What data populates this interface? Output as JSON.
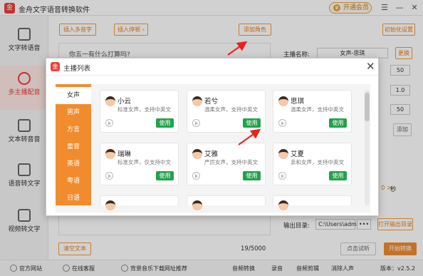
{
  "app": {
    "title": "金舟文字语音转换软件",
    "logo": "金",
    "vip": "开通会员",
    "vip_icon": "crown-icon"
  },
  "window_controls": [
    "☰",
    "—",
    "✕"
  ],
  "sidebar": {
    "items": [
      {
        "label": "文字转语音",
        "icon": "text-to-speech-icon"
      },
      {
        "label": "多主播配音",
        "icon": "multi-anchor-icon",
        "active": true
      },
      {
        "label": "文本转音音",
        "icon": "document-icon"
      },
      {
        "label": "语音转文字",
        "icon": "speech-to-text-icon"
      },
      {
        "label": "视频转文字",
        "icon": "video-to-text-icon"
      }
    ]
  },
  "toolbar": {
    "insert_polyphone": "插入多音字",
    "insert_pause": "插入停顿 ›",
    "add_role": "添加角色",
    "init_settings": "初始化设置"
  },
  "editor": {
    "text": "你五一有什么打算吗?",
    "clear_button": "清空文本",
    "char_count": "19/5000"
  },
  "right_panel": {
    "anchor_label": "主播名称:",
    "anchor_value": "女声-思琪",
    "change_button": "更换",
    "val1": "50",
    "val2": "1.0",
    "val3": "50",
    "add_label": "添加",
    "seconds_unit": "秒",
    "seconds_value": "0 >",
    "output_label": "输出目录:",
    "output_path": "C:\\Users\\admir",
    "output_dots": "•••",
    "open_output": "打开输出目录",
    "try_listen": "点击试听",
    "start_convert": "开始转换"
  },
  "bottom": {
    "items": [
      "官方网站",
      "在线客服",
      "背景音乐下载网址推荐",
      "音频转换",
      "录音",
      "音频剪辑",
      "消除人声"
    ],
    "version": "版本：v2.5.2"
  },
  "modal": {
    "title": "主播列表",
    "logo": "金",
    "close": "✕",
    "categories": [
      "女声",
      "男声",
      "方言",
      "童音",
      "英语",
      "粤语",
      "日语"
    ],
    "use_label": "使用",
    "cards": [
      {
        "name": "小云",
        "desc": "标准女声，支持中英文"
      },
      {
        "name": "若兮",
        "desc": "温柔女声，支持中英文"
      },
      {
        "name": "思琪",
        "desc": "温柔女声，支持中英文"
      },
      {
        "name": "瑞琳",
        "desc": "标准女声，仅支持中文"
      },
      {
        "name": "艾雅",
        "desc": "严厉女声，支持中英文"
      },
      {
        "name": "艾夏",
        "desc": "亲和女声，支持中英文"
      }
    ]
  },
  "colors": {
    "accent": "#f08c2e",
    "brand": "#e8413c",
    "use_green": "#22a24a"
  }
}
